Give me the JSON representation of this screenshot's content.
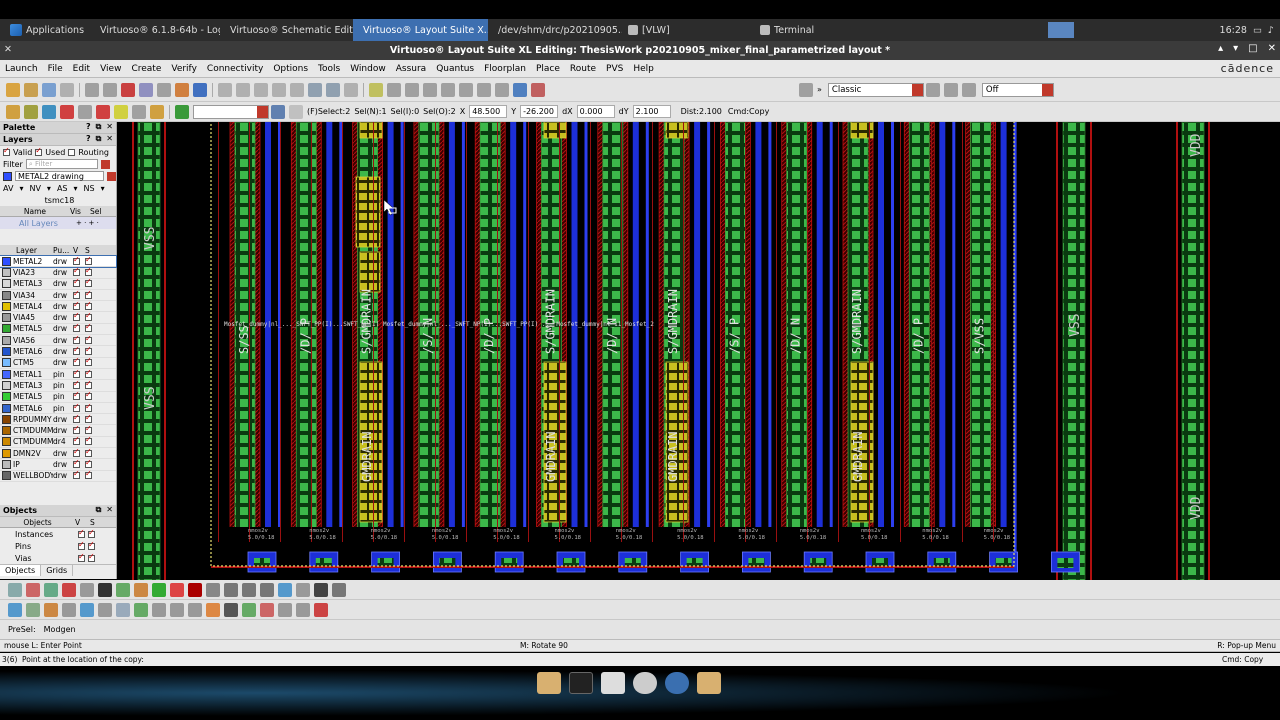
{
  "taskbar": {
    "applications": "Applications",
    "tasks": [
      {
        "label": "Virtuoso® 6.1.8-64b - Log...",
        "active": false
      },
      {
        "label": "Virtuoso® Schematic Edit...",
        "active": false
      },
      {
        "label": "Virtuoso® Layout Suite X...",
        "active": true
      },
      {
        "label": "/dev/shm/drc/p20210905...",
        "active": false
      },
      {
        "label": "[VLW]",
        "active": false
      },
      {
        "label": "Terminal",
        "active": false
      }
    ],
    "clock": "16:28"
  },
  "window": {
    "title": "Virtuoso® Layout Suite XL Editing: ThesisWork p20210905_mixer_final_parametrized layout *"
  },
  "menu": {
    "items": [
      "Launch",
      "File",
      "Edit",
      "View",
      "Create",
      "Verify",
      "Connectivity",
      "Options",
      "Tools",
      "Window",
      "Assura",
      "Quantus",
      "Floorplan",
      "Place",
      "Route",
      "PVS",
      "Help"
    ],
    "brand": "cādence"
  },
  "toolbar": {
    "workspace": "Classic",
    "off_select": "Off"
  },
  "status_line": {
    "fselect": "(F)Select:2",
    "seln": "Sel(N):1",
    "seli": "Sel(I):0",
    "selo": "Sel(O):2",
    "x_label": "X",
    "x_value": "48.500",
    "y_label": "Y",
    "y_value": "-26.200",
    "dx_label": "dX",
    "dx_value": "0.000",
    "dy_label": "dY",
    "dy_value": "2.100",
    "dist": "Dist:2.100",
    "cmd": "Cmd:Copy"
  },
  "palette": {
    "title": "Palette",
    "layers_title": "Layers",
    "valid": "Valid",
    "used": "Used",
    "routing": "Routing",
    "filter_label": "Filter",
    "filter_placeholder": "Filter",
    "current_layer": "METAL2 drawing",
    "vis_row": [
      "AV",
      "NV",
      "AS",
      "NS"
    ],
    "techlib": "tsmc18",
    "name_col": "Name",
    "vis_col": "Vis",
    "sel_col": "Sel",
    "all_layers": "All Layers",
    "layer_header": {
      "layer": "Layer",
      "purpose": "Pu...",
      "v": "V",
      "s": "S"
    },
    "layers": [
      {
        "name": "METAL2",
        "purpose": "drw",
        "color": "#2f4fff"
      },
      {
        "name": "VIA23",
        "purpose": "drw",
        "color": "#c0c0c0"
      },
      {
        "name": "METAL3",
        "purpose": "drw",
        "color": "#d8d8d8"
      },
      {
        "name": "VIA34",
        "purpose": "drw",
        "color": "#888888"
      },
      {
        "name": "METAL4",
        "purpose": "drw",
        "color": "#e0c000"
      },
      {
        "name": "VIA45",
        "purpose": "drw",
        "color": "#999999"
      },
      {
        "name": "METAL5",
        "purpose": "drw",
        "color": "#33aa33"
      },
      {
        "name": "VIA56",
        "purpose": "drw",
        "color": "#aaaaaa"
      },
      {
        "name": "METAL6",
        "purpose": "drw",
        "color": "#2255cc"
      },
      {
        "name": "CTM5",
        "purpose": "drw",
        "color": "#77bbff"
      },
      {
        "name": "METAL1",
        "purpose": "pin",
        "color": "#4466ff"
      },
      {
        "name": "METAL3",
        "purpose": "pin",
        "color": "#d0d0d0"
      },
      {
        "name": "METAL5",
        "purpose": "pin",
        "color": "#33cc33"
      },
      {
        "name": "METAL6",
        "purpose": "pin",
        "color": "#3366cc"
      },
      {
        "name": "RPDUMMY",
        "purpose": "drw",
        "color": "#884400"
      },
      {
        "name": "CTMDUMM",
        "purpose": "drw",
        "color": "#aa6600"
      },
      {
        "name": "CTMDUMM",
        "purpose": "dr4",
        "color": "#cc8800"
      },
      {
        "name": "DMN2V",
        "purpose": "drw",
        "color": "#dd9900"
      },
      {
        "name": "IP",
        "purpose": "drw",
        "color": "#bbbbbb"
      },
      {
        "name": "WELLBODY",
        "purpose": "drw",
        "color": "#666666"
      }
    ]
  },
  "objects": {
    "title": "Objects",
    "col_objects": "Objects",
    "col_v": "V",
    "col_s": "S",
    "rows": [
      "Instances",
      "Pins",
      "Vias"
    ],
    "tab_objects": "Objects",
    "tab_grids": "Grids"
  },
  "canvas": {
    "labels": {
      "vss_left_top": "VSS",
      "vss_left_bottom": "VSS",
      "vss_right": "VSS",
      "vdd_top": "VDD",
      "vdd_bottom": "VDD"
    },
    "device_labels": [
      "S/SS",
      "/D/ P",
      "S/GMDRAIN",
      "/S/ N",
      "/D/ P",
      "S/GMDRAIN",
      "/D/ N",
      "S/GMDRAIN",
      "/S/ P",
      "/D/ N",
      "S/GMDRAIN",
      "/D/ P",
      "S/VSS"
    ],
    "gmdrain_low": [
      "GMDRAIN",
      "GMDRAIN",
      "GMDRAIN",
      "GMDRAIN"
    ],
    "mid_text": "Mosfet_dummy|nl_..._SWFT_PP(I)...SWFT_NP(I) Mosfet_dummy|nl_..._SWFT_NP(I)...SWFT_PP(I) ... Mosfet_dummy|nl_11_Mosfet_2",
    "device_bottom": "nmos2v",
    "device_size": "5.0/0.18"
  },
  "presel": {
    "label": "PreSel:",
    "value": "Modgen"
  },
  "mouse": {
    "left": "mouse L: Enter Point",
    "middle": "M: Rotate 90",
    "right": "R: Pop-up Menu"
  },
  "cmd": {
    "index": "3(6)",
    "prompt": "Point at the location of the copy:",
    "current": "Cmd: Copy"
  }
}
